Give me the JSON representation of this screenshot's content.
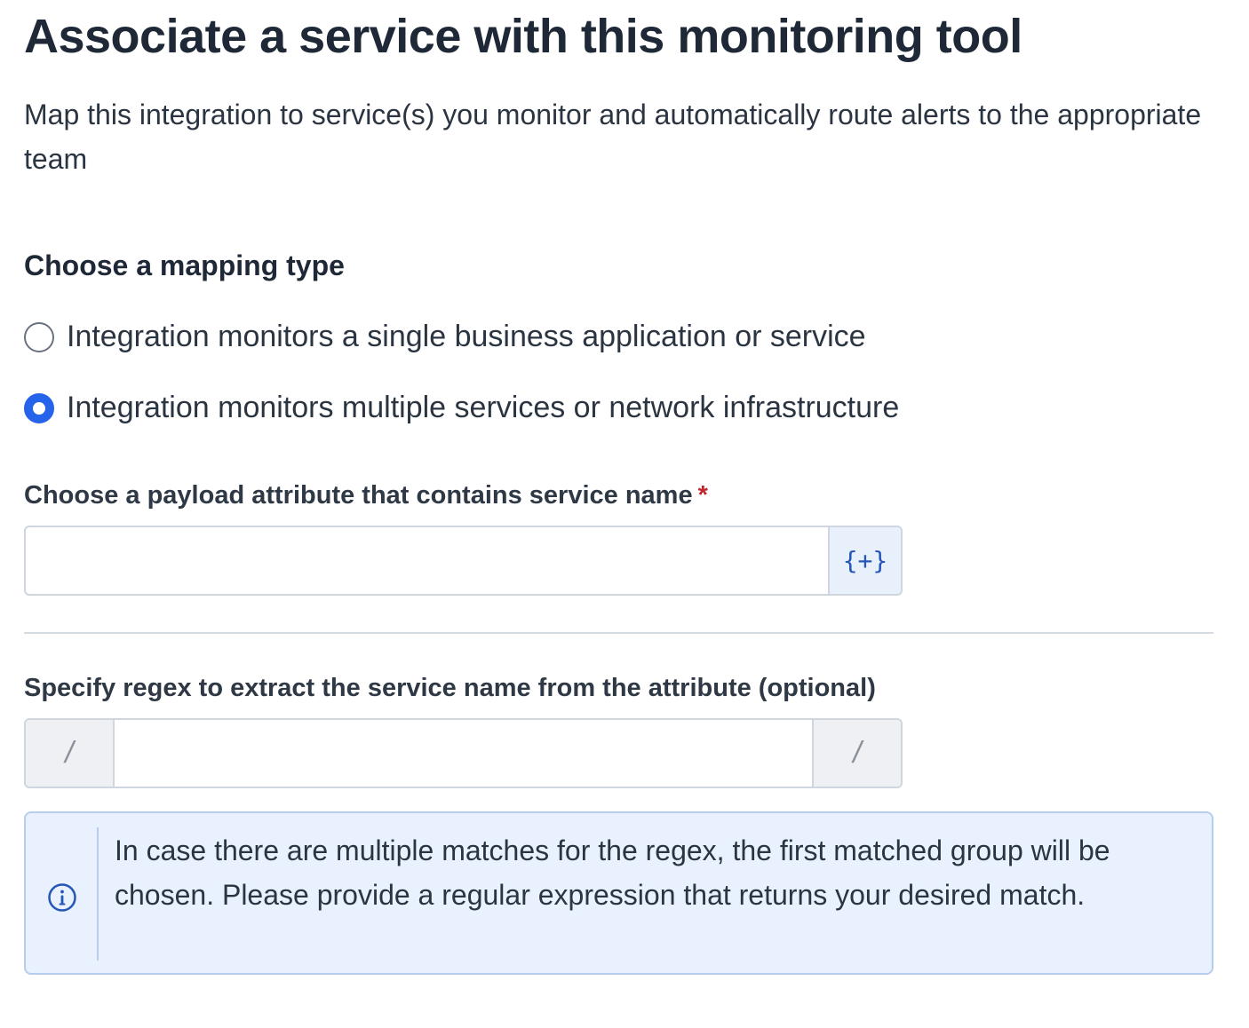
{
  "header": {
    "title": "Associate a service with this monitoring tool",
    "subtitle": "Map this integration to service(s) you monitor and automatically route alerts to the appropriate team"
  },
  "mapping": {
    "heading": "Choose a mapping type",
    "options": [
      {
        "label": "Integration monitors a single business application or service",
        "selected": false
      },
      {
        "label": "Integration monitors multiple services or network infrastructure",
        "selected": true
      }
    ]
  },
  "payload_field": {
    "label": "Choose a payload attribute that contains service name",
    "required_mark": "*",
    "value": "",
    "insert_button_label": "{+}"
  },
  "regex_field": {
    "label": "Specify regex to extract the service name from the attribute (optional)",
    "prefix": "/",
    "suffix": "/",
    "value": ""
  },
  "info": {
    "text": "In case there are multiple matches for the regex, the first matched group will be chosen. Please provide a regular expression that returns your desired match.",
    "icon": "info-icon",
    "accent_color": "#2557b8"
  },
  "colors": {
    "radio_selected": "#2563eb",
    "required": "#c0262d",
    "info_background": "#e8f1fd"
  }
}
